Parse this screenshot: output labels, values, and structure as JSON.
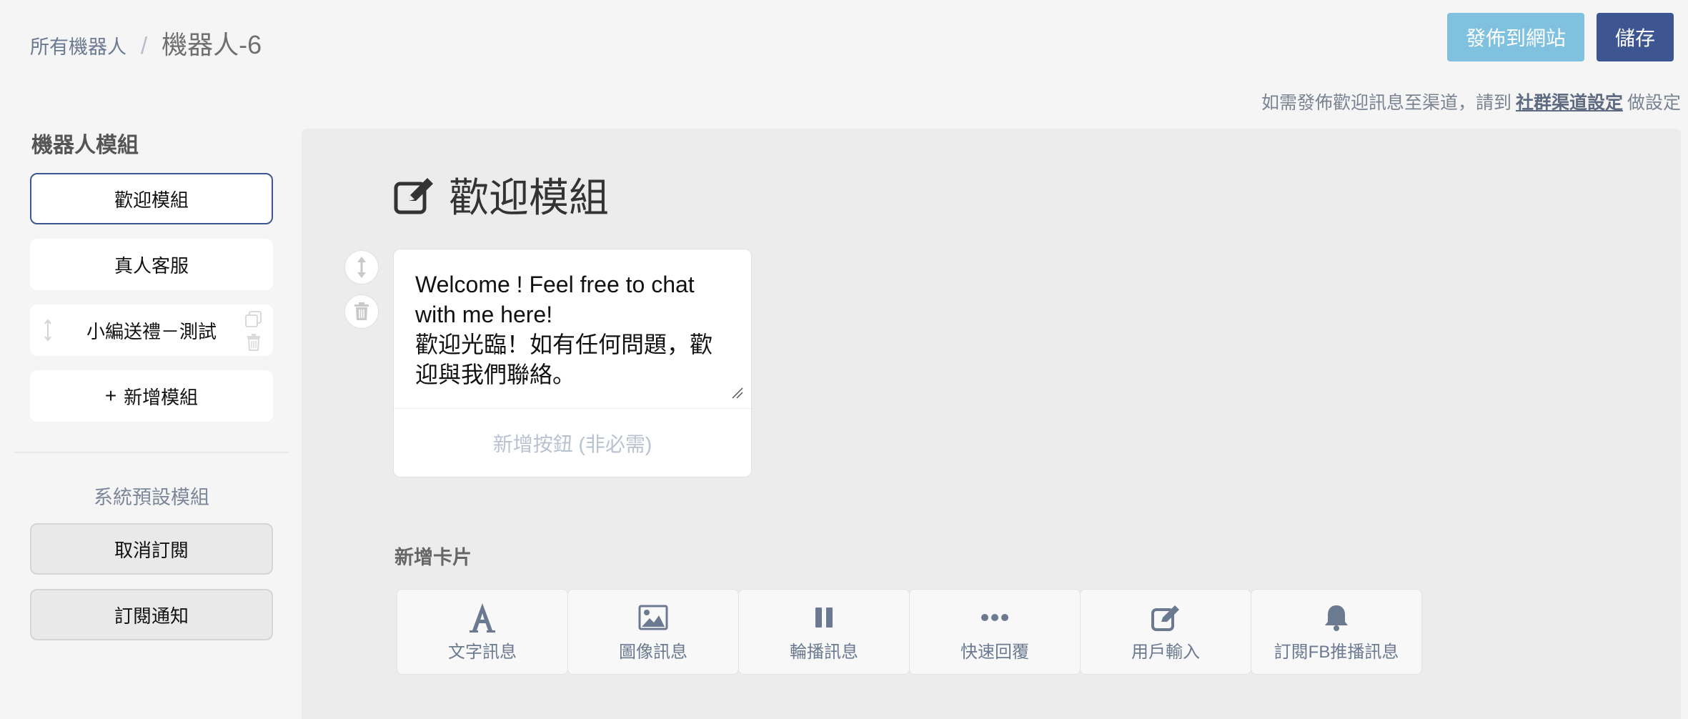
{
  "breadcrumb": {
    "parent": "所有機器人",
    "separator": "/",
    "current": "機器人-6"
  },
  "header": {
    "publish_label": "發佈到網站",
    "save_label": "儲存"
  },
  "notice": {
    "prefix": "如需發佈歡迎訊息至渠道，請到",
    "link": "社群渠道設定",
    "suffix": "做設定"
  },
  "sidebar": {
    "title": "機器人模組",
    "modules": [
      {
        "label": "歡迎模組",
        "active": true
      },
      {
        "label": "真人客服",
        "active": false
      },
      {
        "label": "小編送禮－測試",
        "active": false
      }
    ],
    "add_module_icon": "+",
    "add_module_label": "新增模組",
    "system_title": "系統預設模組",
    "system_modules": [
      {
        "label": "取消訂閱"
      },
      {
        "label": "訂閱通知"
      }
    ]
  },
  "main": {
    "heading": "歡迎模組",
    "heading_icon": "edit-icon",
    "text_card": {
      "content": "Welcome ! Feel free to chat\nwith me here!\n歡迎光臨！如有任何問題，歡\n迎與我們聯絡。",
      "add_button_label": "新增按鈕 (非必需)"
    },
    "add_card_label": "新增卡片",
    "card_types": [
      {
        "icon": "text-a-icon",
        "label": "文字訊息"
      },
      {
        "icon": "image-icon",
        "label": "圖像訊息"
      },
      {
        "icon": "carousel-icon",
        "label": "輪播訊息"
      },
      {
        "icon": "ellipsis-icon",
        "label": "快速回覆"
      },
      {
        "icon": "edit-icon",
        "label": "用戶輸入"
      },
      {
        "icon": "bell-icon",
        "label": "訂閱FB推播訊息"
      }
    ]
  },
  "colors": {
    "publish": "#7fc1df",
    "save": "#3d5692",
    "active_border": "#3d5692",
    "icon_gray": "#6b7a90"
  }
}
